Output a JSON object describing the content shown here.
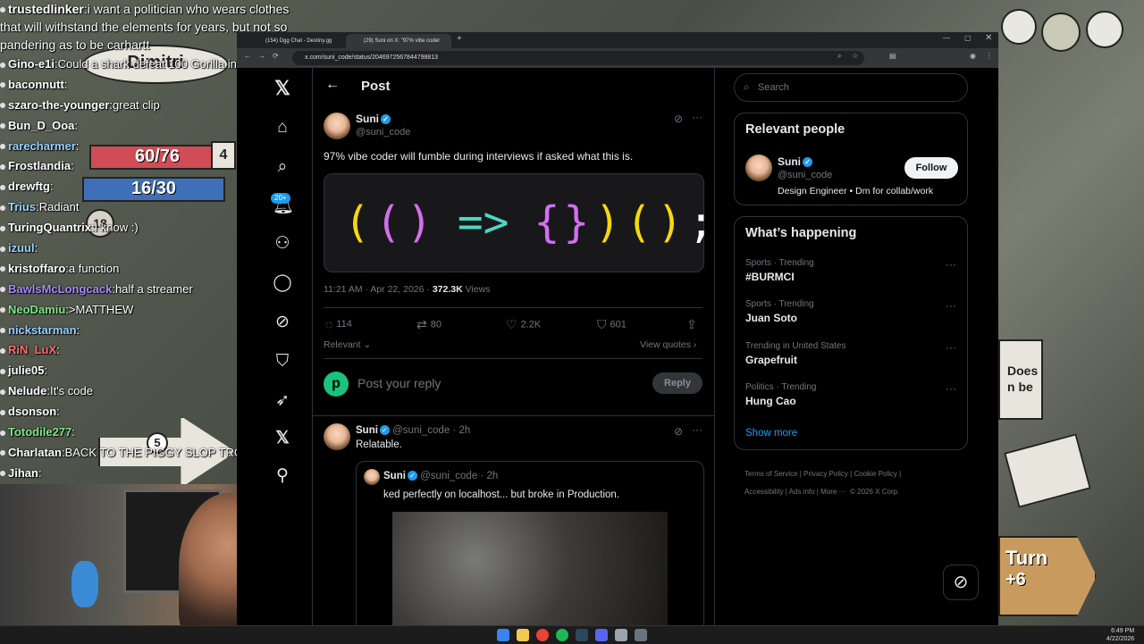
{
  "chat": {
    "messages": [
      {
        "user": "trustedlinker",
        "text": "i want a politician who wears clothes that will withstand the elements for years, but not so pandering as to be carhartt",
        "color": "#ffffff"
      },
      {
        "user": "Gino-e1i",
        "text": "Could a shark defeat 100 Gorilla in Space",
        "color": "#ffffff"
      },
      {
        "user": "baconnutt",
        "text": "",
        "color": "#ffffff"
      },
      {
        "user": "szaro-the-younger",
        "text": "great clip",
        "color": "#ffffff"
      },
      {
        "user": "Bun_D_Ooa",
        "text": "",
        "color": "#ffffff"
      },
      {
        "user": "rarecharmer",
        "text": "",
        "color": "#9ad1ff"
      },
      {
        "user": "Frostlandia",
        "text": "",
        "color": "#ffffff"
      },
      {
        "user": "drewftg",
        "text": "",
        "color": "#ffffff"
      },
      {
        "user": "Trius",
        "text": "Radiant",
        "color": "#9ad1ff"
      },
      {
        "user": "TuringQuantrix",
        "text": "I know :)",
        "color": "#ffffff"
      },
      {
        "user": "izuul",
        "text": "",
        "color": "#9ad1ff"
      },
      {
        "user": "kristoffaro",
        "text": "a function",
        "color": "#ffffff"
      },
      {
        "user": "BawlsMcLongcack",
        "text": "half a streamer",
        "color": "#a78bfa"
      },
      {
        "user": "NeoDamiu",
        "text": ">MATTHEW",
        "color": "#7ee787"
      },
      {
        "user": "nickstarman",
        "text": "",
        "color": "#9ad1ff"
      },
      {
        "user": "RiN_LuX",
        "text": "",
        "color": "#ff6b6b"
      },
      {
        "user": "julie05",
        "text": "",
        "color": "#ffffff"
      },
      {
        "user": "Nelude",
        "text": "It's code",
        "color": "#ffffff"
      },
      {
        "user": "dsonson",
        "text": "",
        "color": "#ffffff"
      },
      {
        "user": "Totodile277",
        "text": "",
        "color": "#7ee787"
      },
      {
        "user": "Charlatan",
        "text": "BACK TO THE PIGGY SLOP TROUGH",
        "color": "#ffffff"
      },
      {
        "user": "Jihan",
        "text": "",
        "color": "#ffffff"
      }
    ]
  },
  "game": {
    "player_name": "Dimitri",
    "hp": "60/76",
    "shield": "16/30",
    "level_badge": "4",
    "count_badge": "18",
    "sign_does": "Does",
    "sign_nbe": "n be",
    "sign_turn": "Turn",
    "sign_plus6": "+6",
    "sign_five": "5"
  },
  "browser": {
    "tabs": [
      {
        "title": "(154) Dgg Chat - Destiny.gg",
        "active": false
      },
      {
        "title": "(29) Suni on X: \"97% vibe coder",
        "active": true
      }
    ],
    "new_tab": "+",
    "url": "x.com/suni_code/status/2046972567844798813"
  },
  "xnav": {
    "notifications_badge": "20+"
  },
  "post": {
    "header": "Post",
    "author": "Suni",
    "handle": "@suni_code",
    "text": "97% vibe coder will fumble during interviews if asked what this is.",
    "code": [
      "(",
      "(",
      ")",
      "=>",
      "{",
      "}",
      ")",
      "(",
      ")",
      ";"
    ],
    "code_colors": [
      "#f5d90a",
      "#d36ef0",
      "#d36ef0",
      "#4dd6c4",
      "#d36ef0",
      "#d36ef0",
      "#f5d90a",
      "#f5d90a",
      "#f5d90a",
      "#ffffff"
    ],
    "time": "11:21 AM · Apr 22, 2026",
    "views_count": "372.3K",
    "views_label": "Views",
    "replies": "114",
    "reposts": "80",
    "likes": "2.2K",
    "bookmarks": "601",
    "sort_label": "Relevant",
    "view_quotes": "View quotes",
    "reply_placeholder": "Post your reply",
    "reply_button": "Reply"
  },
  "reply_post": {
    "author": "Suni",
    "handle": "@suni_code",
    "time": "2h",
    "text": "Relatable.",
    "quote_author": "Suni",
    "quote_handle": "@suni_code",
    "quote_time": "2h",
    "quote_text": "ked perfectly on localhost... but broke in Production."
  },
  "sidebar": {
    "search_placeholder": "Search",
    "relevant_title": "Relevant people",
    "person_name": "Suni",
    "person_handle": "@suni_code",
    "person_bio": "Design Engineer • Dm for collab/work",
    "follow_label": "Follow",
    "happening_title": "What’s happening",
    "trends": [
      {
        "category": "Sports · Trending",
        "title": "#BURMCI"
      },
      {
        "category": "Sports · Trending",
        "title": "Juan Soto"
      },
      {
        "category": "Trending in United States",
        "title": "Grapefruit"
      },
      {
        "category": "Politics · Trending",
        "title": "Hung Cao"
      }
    ],
    "show_more": "Show more",
    "footer_links": [
      "Terms of Service",
      "Privacy Policy",
      "Cookie Policy",
      "Accessibility",
      "Ads info",
      "More ···",
      "© 2026 X Corp."
    ]
  },
  "taskbar": {
    "time": "6:49 PM",
    "date": "4/22/2026"
  }
}
